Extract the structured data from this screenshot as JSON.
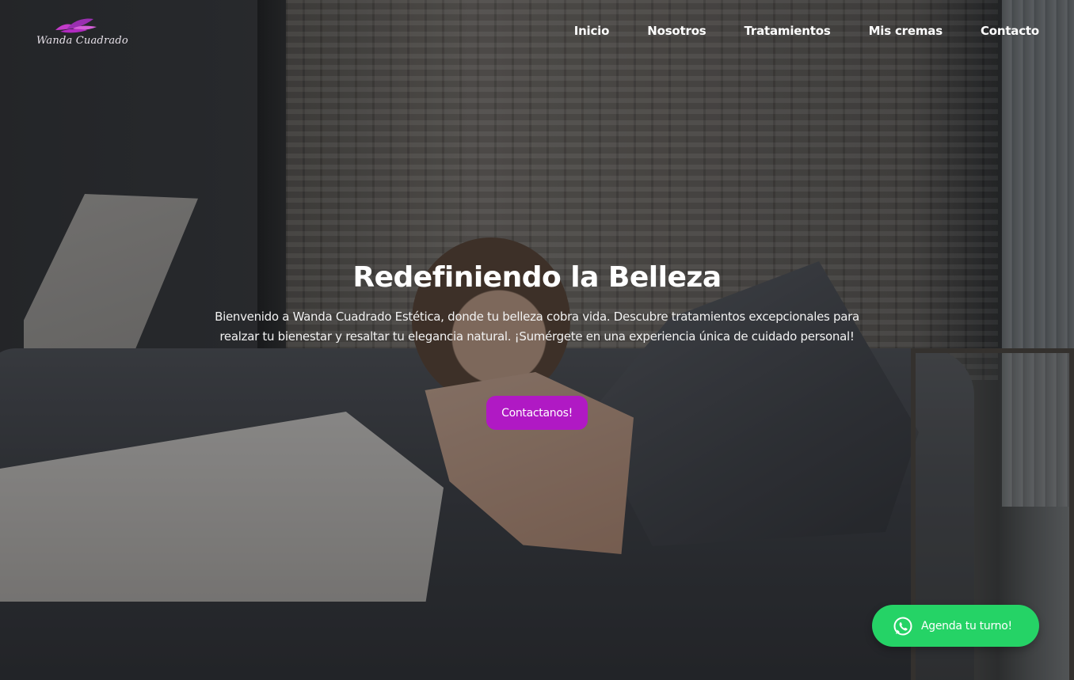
{
  "brand": {
    "name": "Wanda Cuadrado",
    "logo_icon": "lotus-flower-icon",
    "accent_color": "#b019c4"
  },
  "nav": {
    "items": [
      {
        "label": "Inicio"
      },
      {
        "label": "Nosotros"
      },
      {
        "label": "Tratamientos"
      },
      {
        "label": "Mis cremas"
      },
      {
        "label": "Contacto"
      }
    ]
  },
  "hero": {
    "title": "Redefiniendo la Belleza",
    "description": "Bienvenido a Wanda Cuadrado Estética, donde tu belleza cobra vida. Descubre tratamientos excepcionales para realzar tu bienestar y resaltar tu elegancia natural. ¡Sumérgete en una experiencia única de cuidado personal!",
    "cta_label": "Contactanos!",
    "cta_color": "#b019c4"
  },
  "whatsapp": {
    "label": "Agenda tu turno!",
    "icon": "whatsapp-icon",
    "color": "#25d366"
  }
}
